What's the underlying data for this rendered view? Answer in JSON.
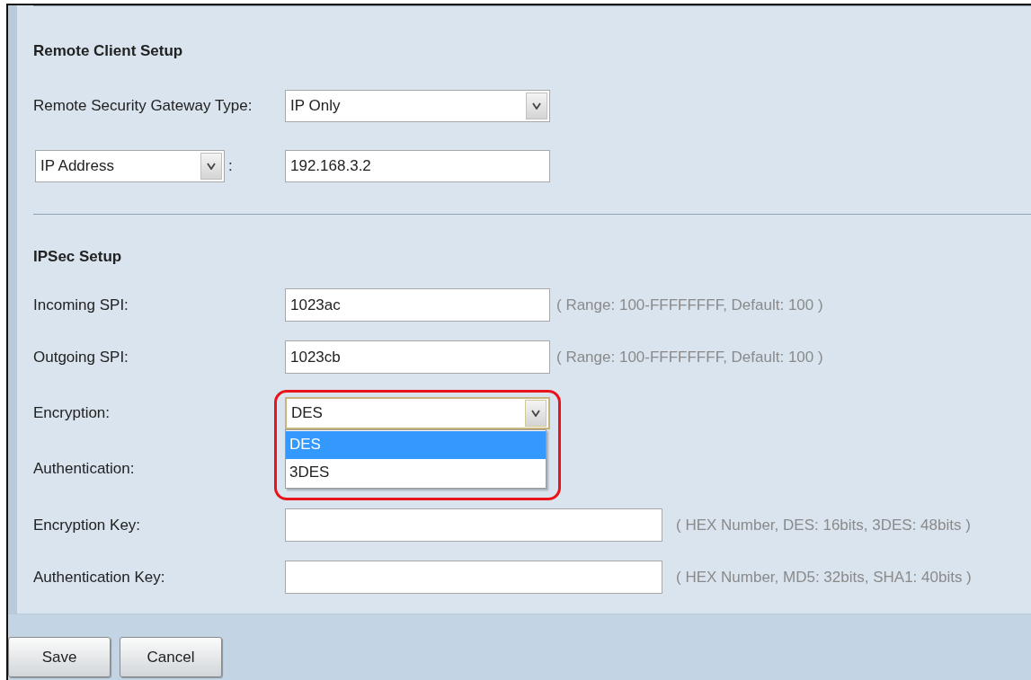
{
  "sections": [
    {
      "title": "Remote Client Setup",
      "rows": [
        {
          "kind": "select",
          "label": "Remote Security Gateway Type:",
          "value": "IP Only"
        },
        {
          "kind": "typed_input",
          "type_value": "IP Address",
          "separator": ":",
          "value": "192.168.3.2"
        }
      ]
    },
    {
      "title": "IPSec Setup",
      "rows": [
        {
          "kind": "text",
          "label": "Incoming SPI:",
          "value": "1023ac",
          "hint": "( Range: 100-FFFFFFFF, Default: 100 )"
        },
        {
          "kind": "text",
          "label": "Outgoing SPI:",
          "value": "1023cb",
          "hint": "( Range: 100-FFFFFFFF, Default: 100 )"
        },
        {
          "kind": "select",
          "label": "Encryption:",
          "value": "DES",
          "focused": true,
          "expanded": true,
          "highlighted": true,
          "options": [
            {
              "label": "DES",
              "selected": true
            },
            {
              "label": "3DES",
              "selected": false
            }
          ]
        },
        {
          "kind": "label",
          "label": "Authentication:"
        },
        {
          "kind": "wide_text",
          "label": "Encryption Key:",
          "hint": "( HEX Number, DES: 16bits, 3DES: 48bits )"
        },
        {
          "kind": "wide_text",
          "label": "Authentication Key:",
          "hint": "( HEX Number, MD5: 32bits, SHA1: 40bits )"
        }
      ]
    }
  ],
  "buttons": [
    "Save",
    "Cancel"
  ]
}
